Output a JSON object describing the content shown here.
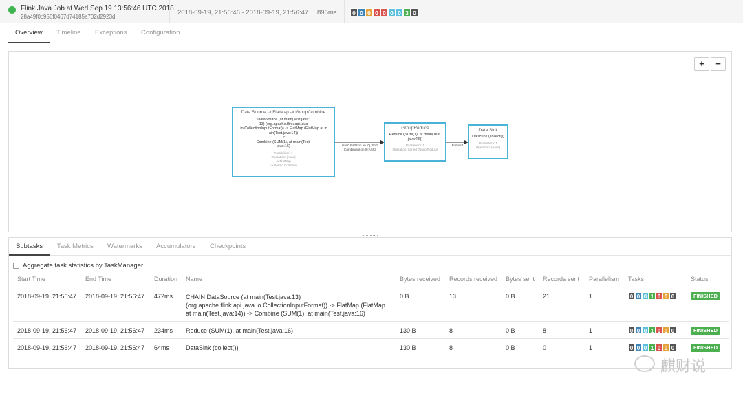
{
  "header": {
    "job_title": "Flink Java Job at Wed Sep 19 13:56:46 UTC 2018",
    "job_id": "28a49f0c956f0467d74185a702d2923d",
    "time_range": "2018-09-19, 21:56:46 - 2018-09-19, 21:56:47",
    "duration": "895ms",
    "status_counts": [
      {
        "value": "0",
        "color": "#555555"
      },
      {
        "value": "0",
        "color": "#3d84b8"
      },
      {
        "value": "0",
        "color": "#e6a23c"
      },
      {
        "value": "0",
        "color": "#d9534f"
      },
      {
        "value": "0",
        "color": "#d9534f"
      },
      {
        "value": "0",
        "color": "#5bc0de"
      },
      {
        "value": "0",
        "color": "#5bc0de"
      },
      {
        "value": "3",
        "color": "#4caf50"
      },
      {
        "value": "0",
        "color": "#555555"
      }
    ]
  },
  "tabs": [
    "Overview",
    "Timeline",
    "Exceptions",
    "Configuration"
  ],
  "plan": {
    "zoom_in": "+",
    "zoom_out": "−",
    "nodes": [
      {
        "title": "Data Source -> FlatMap -> GroupCombine",
        "lines": [
          "DataSource (at main(Test.java:",
          "13) (org.apache.flink.api.java",
          ".io.CollectionInputFormat)) -> FlatMap (FlatMap at m",
          "ain(Test.java:14))",
          "->",
          "Combine (SUM(1), at main(Test.",
          "java:16)"
        ],
        "small": [
          "Parallelism: 1",
          "",
          "Operation: (none)",
          "-> FlatMap",
          "",
          "-> Sorted Combine"
        ]
      },
      {
        "title": "GroupReduce",
        "lines": [
          "Reduce (SUM(1), at main(Test.",
          "java:16))"
        ],
        "small": [
          "Parallelism: 1",
          "",
          "Operation: Sorted Group Reduce"
        ]
      },
      {
        "title": "Data Sink",
        "lines": [
          "DataSink (collect())"
        ],
        "small": [
          "Parallelism: 1",
          "",
          "Operation: (none)"
        ]
      }
    ],
    "edges": [
      {
        "label": "Hash Partition on [0], Sort (combining) on [0:ASC]"
      },
      {
        "label": "Forward"
      }
    ]
  },
  "subtabs": [
    "Subtasks",
    "Task Metrics",
    "Watermarks",
    "Accumulators",
    "Checkpoints"
  ],
  "aggregate_label": "Aggregate task statistics by TaskManager",
  "table": {
    "headers": [
      "Start Time",
      "End Time",
      "Duration",
      "Name",
      "Bytes received",
      "Records received",
      "Bytes sent",
      "Records sent",
      "Parallelism",
      "Tasks",
      "Status"
    ],
    "rows": [
      {
        "start": "2018-09-19, 21:56:47",
        "end": "2018-09-19, 21:56:47",
        "duration": "472ms",
        "name": [
          "CHAIN DataSource (at main(Test.java:13)",
          "(org.apache.flink.api.java.io.CollectionInputFormat)) -> FlatMap (FlatMap",
          "at main(Test.java:14)) -> Combine (SUM(1), at main(Test.java:16)"
        ],
        "bytes_received": "0 B",
        "records_received": "13",
        "bytes_sent": "0 B",
        "records_sent": "21",
        "parallelism": "1",
        "tasks": [
          "0",
          "0",
          "0",
          "1",
          "0",
          "0",
          "0"
        ],
        "status": "FINISHED"
      },
      {
        "start": "2018-09-19, 21:56:47",
        "end": "2018-09-19, 21:56:47",
        "duration": "234ms",
        "name": [
          "Reduce (SUM(1), at main(Test.java:16)"
        ],
        "bytes_received": "130 B",
        "records_received": "8",
        "bytes_sent": "0 B",
        "records_sent": "8",
        "parallelism": "1",
        "tasks": [
          "0",
          "0",
          "0",
          "1",
          "0",
          "0",
          "0"
        ],
        "status": "FINISHED"
      },
      {
        "start": "2018-09-19, 21:56:47",
        "end": "2018-09-19, 21:56:47",
        "duration": "64ms",
        "name": [
          "DataSink (collect())"
        ],
        "bytes_received": "130 B",
        "records_received": "8",
        "bytes_sent": "0 B",
        "records_sent": "0",
        "parallelism": "1",
        "tasks": [
          "0",
          "0",
          "0",
          "1",
          "0",
          "0",
          "0"
        ],
        "status": "FINISHED"
      }
    ],
    "task_colors": [
      "#555555",
      "#3d84b8",
      "#5bc0de",
      "#4caf50",
      "#d9534f",
      "#e6a23c",
      "#555555"
    ]
  },
  "watermark": "麒财说"
}
